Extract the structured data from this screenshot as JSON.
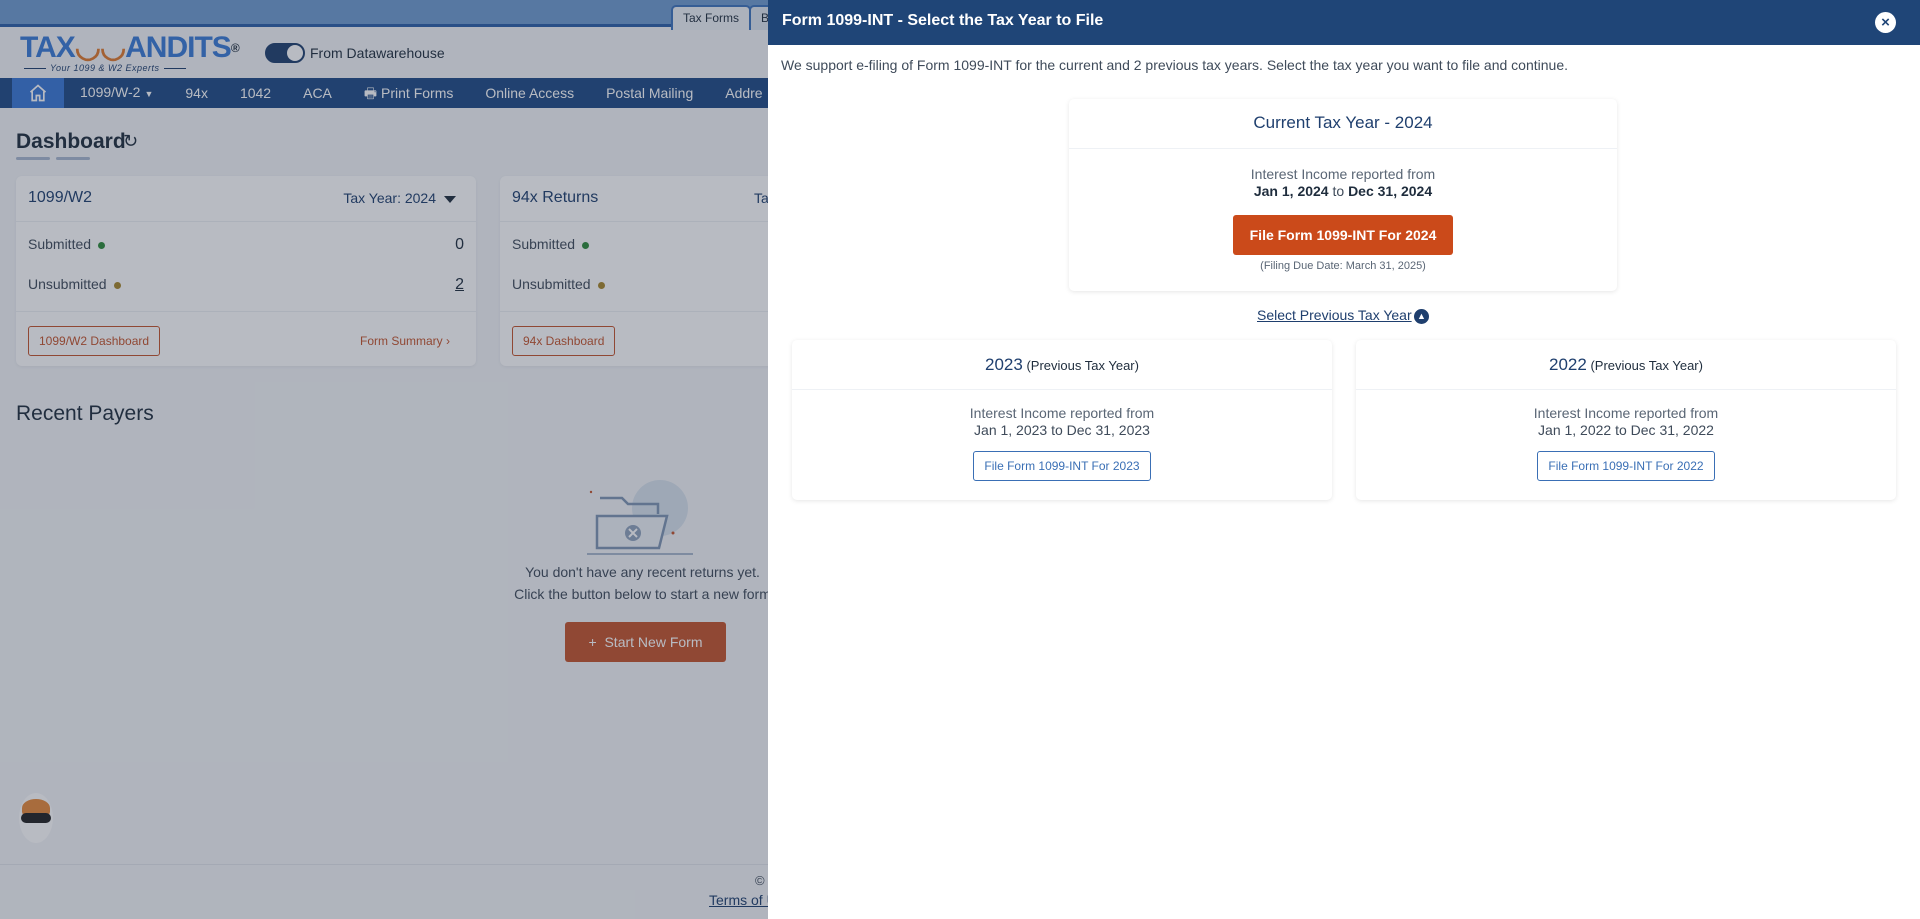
{
  "top_tabs": [
    {
      "label": "Tax Forms",
      "active": true
    },
    {
      "label": "B",
      "active": false
    }
  ],
  "brand": {
    "logo_text_left": "TAX",
    "logo_text_right": "ANDITS",
    "logo_reg": "®",
    "logo_tagline": "Your 1099 & W2 Experts",
    "datawarehouse_toggle_label": "From Datawarehouse",
    "datawarehouse_toggle_on": true
  },
  "nav": {
    "home_icon": "home-icon",
    "items": [
      {
        "label": "1099/W-2",
        "has_dropdown": true
      },
      {
        "label": "94x"
      },
      {
        "label": "1042"
      },
      {
        "label": "ACA"
      },
      {
        "label": "Print Forms",
        "icon": "printer-icon"
      },
      {
        "label": "Online Access"
      },
      {
        "label": "Postal Mailing"
      },
      {
        "label": "Addre"
      }
    ]
  },
  "dashboard": {
    "title": "Dashboard",
    "refresh_icon": "refresh-icon",
    "cards": [
      {
        "title": "1099/W2",
        "tax_year_label": "Tax Year: 2024",
        "submitted_label": "Submitted",
        "submitted_value": "0",
        "unsubmitted_label": "Unsubmitted",
        "unsubmitted_value": "2",
        "dashboard_button": "1099/W2 Dashboard",
        "summary_link": "Form Summary",
        "summary_arrow": "›"
      },
      {
        "title": "94x Returns",
        "tax_year_label": "Ta",
        "submitted_label": "Submitted",
        "unsubmitted_label": "Unsubmitted",
        "dashboard_button": "94x Dashboard"
      }
    ],
    "status_colors": {
      "submitted": "#2e8b3a",
      "unsubmitted": "#a8862a"
    }
  },
  "recent_payers": {
    "title": "Recent Payers",
    "empty_line1": "You don't have any recent returns yet.",
    "empty_line2": "Click the button below to start a new form",
    "start_button": "Start New Form",
    "start_icon": "+"
  },
  "footer": {
    "copyright": "©",
    "terms": "Terms of U"
  },
  "modal": {
    "title": "Form 1099-INT - Select the Tax Year to File",
    "close_icon": "×",
    "subtitle": "We support e-filing of Form 1099-INT for the current and 2 previous tax years. Select the tax year you want to file and continue.",
    "current": {
      "title": "Current Tax Year - 2024",
      "desc": "Interest Income reported from",
      "from": "Jan 1, 2024",
      "to_word": "to",
      "to": "Dec 31, 2024",
      "button": "File Form 1099-INT For 2024",
      "due_date": "(Filing Due Date: March 31, 2025)"
    },
    "previous_toggle": "Select Previous Tax Year",
    "previous_toggle_icon": "^",
    "previous": [
      {
        "year": "2023",
        "suffix": "(Previous Tax Year)",
        "desc": "Interest Income reported from",
        "range": "Jan 1, 2023 to Dec 31, 2023",
        "button": "File Form 1099-INT For 2023"
      },
      {
        "year": "2022",
        "suffix": "(Previous Tax Year)",
        "desc": "Interest Income reported from",
        "range": "Jan 1, 2022 to Dec 31, 2022",
        "button": "File Form 1099-INT For 2022"
      }
    ],
    "colors": {
      "header": "#1f4577",
      "primary": "#cb4a1a",
      "secondary": "#3a6fb5"
    }
  }
}
